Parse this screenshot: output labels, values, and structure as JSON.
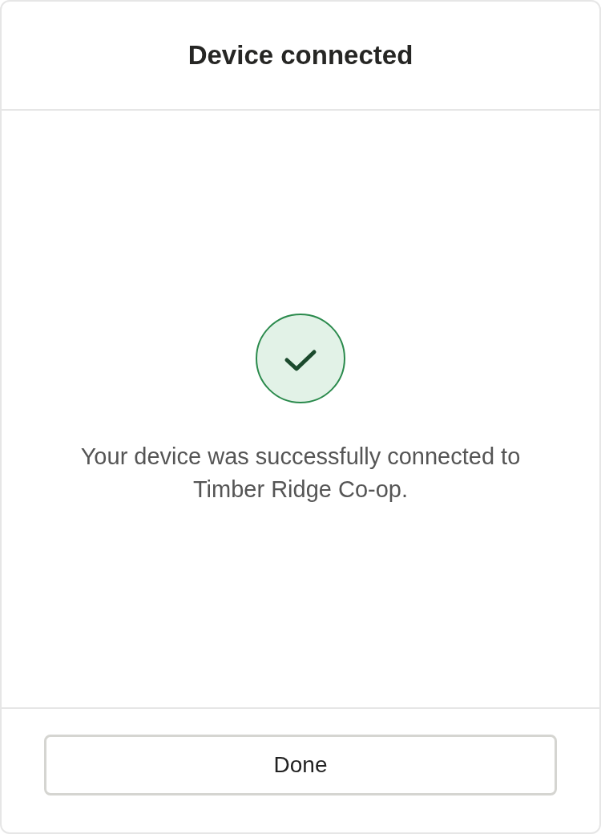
{
  "dialog": {
    "title": "Device connected",
    "message": "Your device was successfully connected to Timber Ridge Co-op.",
    "buttons": [
      {
        "label": "Done"
      }
    ]
  }
}
